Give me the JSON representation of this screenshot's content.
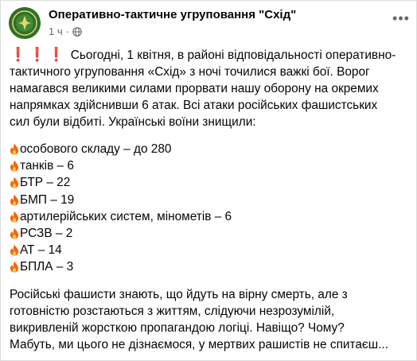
{
  "post": {
    "page_name": "Оперативно-тактичне угруповання \"Схід\"",
    "time": "1 ч",
    "separator": "·",
    "more_icon": "more-horizontal-icon",
    "privacy_icon": "globe-icon",
    "exclamations": "❗❗❗",
    "intro_line1": " Сьогодні, 1 квітня, в районі відповідальності оперативно-",
    "intro_line2": "тактичного угруповання «Схід» з ночі точилися важкі  бої. Ворог",
    "intro_line3": "намагався великими силами прорвати нашу оборону на окремих",
    "intro_line4": "напрямках здійснивши 6 атак. Всі атаки російських фашистських",
    "intro_line5": "сил були відбиті. Українські воїни знищили:",
    "losses": [
      "особового складу – до 280",
      "танків – 6",
      "БТР – 22",
      "БМП – 19",
      "артилерійських систем, мінометів – 6",
      "РСЗВ – 2",
      "АТ – 14",
      "БПЛА – 3"
    ],
    "outro_line1": "Російські фашисти знають, що йдуть на вірну смерть, але з",
    "outro_line2": "готовністю розстаються з життям, слідуючи незрозумілій,",
    "outro_line3": "викривленій жорсткою пропагандою логіці. Навіщо? Чому?",
    "outro_line4": "Мабуть, ми цього не дізнаємося, у мертвих рашистів не спитаєш..."
  },
  "colors": {
    "fire": "#f7630c",
    "exclamation": "#e41e3f",
    "avatar": "#2f6f2a"
  }
}
